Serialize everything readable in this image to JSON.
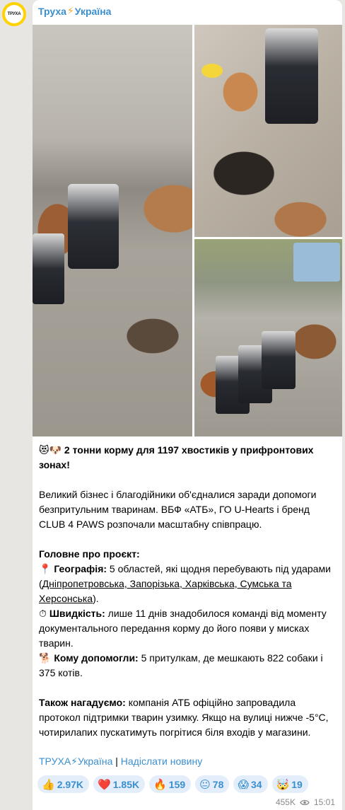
{
  "channel": {
    "name_part1": "Труха",
    "name_bolt": "⚡",
    "name_part2": "Україна",
    "avatar_text": "ТРУХА"
  },
  "post": {
    "headline_emojis": "😻🐶",
    "headline": "2 тонни корму для 1197 хвостиків у прифронтових зонах!",
    "intro": "Великий бізнес і благодійники об'єдналися заради допомоги безпритульним тваринам. ВБФ «АТБ», ГО U-Hearts і бренд CLUB 4 PAWS розпочали масштабну співпрацю.",
    "section_title": "Головне про проєкт:",
    "geo_icon": "📍",
    "geo_label": "Географія:",
    "geo_text": " 5 областей, які щодня перебувають під ударами (",
    "geo_regions": "Дніпропетровська, Запорізька, Харківська, Сумська та Херсонська",
    "geo_close": ").",
    "speed_icon": "⏱",
    "speed_label": "Швидкість:",
    "speed_text": " лише 11 днів знадобилося команді від моменту документального передання корму до його появи у мисках тварин.",
    "who_icon": "🐕",
    "who_label": "Кому допомогли:",
    "who_text": " 5 притулкам, де мешкають 822 собаки і 375 котів.",
    "remind_label": "Також нагадуємо:",
    "remind_text": " компанія АТБ офіційно запровадила протокол підтримки тварин узимку. Якщо на вулиці нижче -5°C, чотирилапих пускатимуть погрітися біля входів у магазини."
  },
  "footer": {
    "channel_link": "ТРУХА⚡Україна",
    "separator": " | ",
    "submit_link": "Надіслати новину"
  },
  "reactions": [
    {
      "emoji": "👍",
      "count": "2.97K"
    },
    {
      "emoji": "❤️",
      "count": "1.85K"
    },
    {
      "emoji": "🔥",
      "count": "159"
    },
    {
      "emoji": "😐",
      "count": "78"
    },
    {
      "emoji": "😱",
      "count": "34"
    },
    {
      "emoji": "🤯",
      "count": "19"
    }
  ],
  "meta": {
    "views": "455K",
    "time": "15:01"
  },
  "colors": {
    "accent": "#3a8fcf",
    "reaction_bg": "#e3eefa",
    "avatar_yellow": "#ffd200"
  }
}
